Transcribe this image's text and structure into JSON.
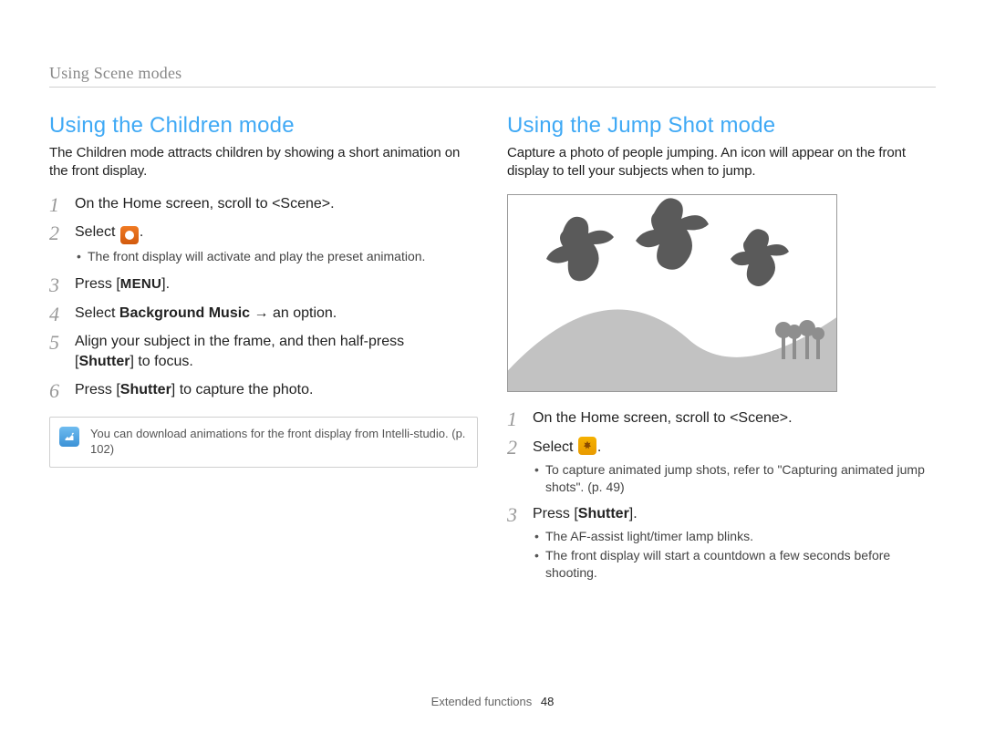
{
  "breadcrumb": "Using Scene modes",
  "left": {
    "heading": "Using the Children mode",
    "intro": "The Children mode attracts children by showing a short animation on the front display.",
    "steps": {
      "s1": "On the Home screen, scroll to <Scene>.",
      "s2_pre": "Select ",
      "s2_post": ".",
      "s2_sub1": "The front display will activate and play the preset animation.",
      "s3_pre": "Press [",
      "s3_menu": "MENU",
      "s3_post": "].",
      "s4_pre": "Select ",
      "s4_bold": "Background Music",
      "s4_post": " → an option.",
      "s5_line1": "Align your subject in the frame, and then half-press",
      "s5_line2_pre": "[",
      "s5_line2_bold": "Shutter",
      "s5_line2_post": "] to focus.",
      "s6_pre": "Press [",
      "s6_bold": "Shutter",
      "s6_post": "] to capture the photo."
    },
    "note": "You can download animations for the front display from Intelli-studio. (p. 102)"
  },
  "right": {
    "heading": "Using the Jump Shot mode",
    "intro": "Capture a photo of people jumping. An icon will appear on the front display to tell your subjects when to jump.",
    "steps": {
      "s1": "On the Home screen, scroll to <Scene>.",
      "s2_pre": "Select ",
      "s2_post": ".",
      "s2_sub1": "To capture animated jump shots, refer to \"Capturing animated jump shots\". (p. 49)",
      "s3_pre": "Press [",
      "s3_bold": "Shutter",
      "s3_post": "].",
      "s3_sub1": "The AF-assist light/timer lamp blinks.",
      "s3_sub2": "The front display will start a countdown a few seconds before shooting."
    }
  },
  "footer": {
    "section": "Extended functions",
    "page": "48"
  }
}
